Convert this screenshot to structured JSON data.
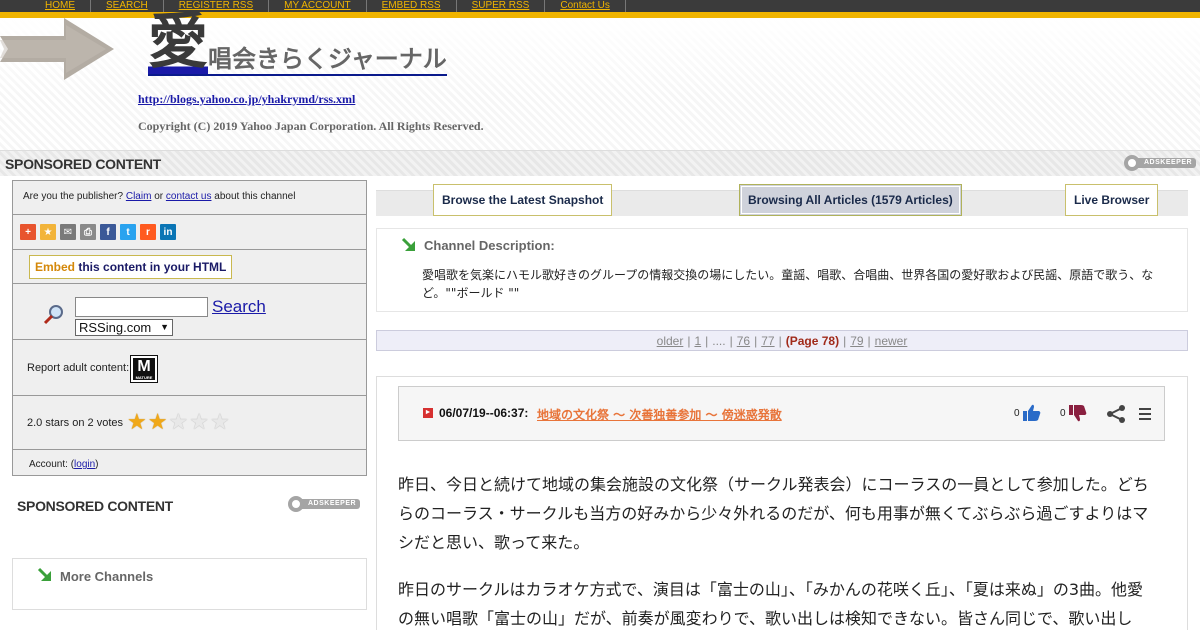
{
  "topnav": [
    "HOME",
    "SEARCH",
    "REGISTER RSS",
    "MY ACCOUNT",
    "EMBED RSS",
    "SUPER RSS",
    "Contact Us"
  ],
  "header": {
    "title_big": "愛",
    "title_rest": "唱会きらくジャーナル",
    "rss_url": "http://blogs.yahoo.co.jp/yhakrymd/rss.xml",
    "copyright": "Copyright (C) 2019 Yahoo Japan Corporation. All Rights Reserved."
  },
  "sponsored_label": "SPONSORED CONTENT",
  "adskeeper_label": "ADSKEEPER",
  "left_panel": {
    "publisher_prefix": "Are you the publisher?",
    "claim_link": "Claim",
    "or_text": "or",
    "contact_link": "contact us",
    "publisher_suffix": "about this channel",
    "share_icons": [
      {
        "name": "add-icon",
        "glyph": "+",
        "color": "#e8542e"
      },
      {
        "name": "bookmark-star-icon",
        "glyph": "★",
        "color": "#f2b43a"
      },
      {
        "name": "email-icon",
        "glyph": "✉",
        "color": "#7a7a7a"
      },
      {
        "name": "print-icon",
        "glyph": "⎙",
        "color": "#8a8a8a"
      },
      {
        "name": "facebook-icon",
        "glyph": "f",
        "color": "#3b5998"
      },
      {
        "name": "twitter-icon",
        "glyph": "t",
        "color": "#2aa3ef"
      },
      {
        "name": "reddit-icon",
        "glyph": "r",
        "color": "#ff5a1f"
      },
      {
        "name": "linkedin-icon",
        "glyph": "in",
        "color": "#0a75b5"
      }
    ],
    "embed_word": "Embed",
    "embed_rest": "this content in your HTML",
    "search_button": "Search",
    "search_value": "",
    "site_select": "RSSing.com",
    "report_label": "Report adult content:",
    "mature_icon_letter": "M",
    "mature_icon_sub": "MATURE",
    "stars_text": "2.0 stars on 2 votes",
    "stars_filled": 2,
    "stars_total": 5,
    "account_prefix": "Account: (",
    "login_link": "login",
    "account_suffix": ")"
  },
  "more_channels": "More Channels",
  "tabs": {
    "latest": "Browse the Latest Snapshot",
    "all": "Browsing All Articles (1579 Articles)",
    "live": "Live Browser"
  },
  "channel": {
    "title": "Channel Description:",
    "text": "愛唱歌を気楽にハモル歌好きのグループの情報交換の場にしたい。童謡、唱歌、合唱曲、世界各国の愛好歌および民謡、原語で歌う、など。\"\"ボールド \"\""
  },
  "pager": {
    "older": "older",
    "p1": "1",
    "dots": "....",
    "p76": "76",
    "p77": "77",
    "current": "(Page 78)",
    "p79": "79",
    "newer": "newer"
  },
  "article": {
    "date": "06/07/19--06:37:",
    "title": "地域の文化祭 ～ 次善独善参加 ～ 傍迷惑発散",
    "likes": "0",
    "dislikes": "0",
    "para1": "昨日、今日と続けて地域の集会施設の文化祭（サークル発表会）にコーラスの一員として参加した。どちらのコーラス・サークルも当方の好みから少々外れるのだが、何も用事が無くてぶらぶら過ごすよりはマシだと思い、歌って来た。",
    "para2": "昨日のサークルはカラオケ方式で、演目は「富士の山」、「みかんの花咲く丘」、「夏は来ぬ」の3曲。他愛の無い唱歌「富士の山」だが、前奏が風変わりで、歌い出しは検知できない。皆さん同じで、歌い出し"
  }
}
